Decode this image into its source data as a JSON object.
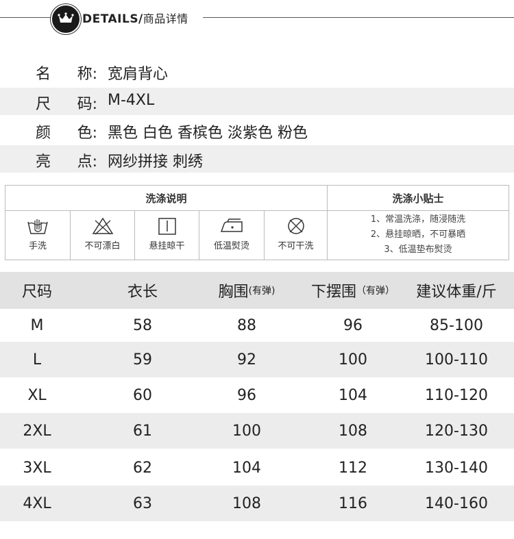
{
  "header": {
    "title": "DETAILS/",
    "subtitle": "商品详情"
  },
  "specs": [
    {
      "label_a": "名",
      "label_b": "称:",
      "value": "宽肩背心"
    },
    {
      "label_a": "尺",
      "label_b": "码:",
      "value": "M-4XL"
    },
    {
      "label_a": "颜",
      "label_b": "色:",
      "value": "黑色 白色 香槟色 淡紫色 粉色"
    },
    {
      "label_a": "亮",
      "label_b": "点:",
      "value": "网纱拼接  刺绣"
    }
  ],
  "care": {
    "left_title": "洗涤说明",
    "right_title": "洗涤小贴士",
    "icons": [
      {
        "label": "手洗",
        "icon": "hand-wash-icon"
      },
      {
        "label": "不可漂白",
        "icon": "no-bleach-icon"
      },
      {
        "label": "悬挂晾干",
        "icon": "hang-dry-icon"
      },
      {
        "label": "低温熨烫",
        "icon": "low-iron-icon"
      },
      {
        "label": "不可干洗",
        "icon": "no-dry-clean-icon"
      }
    ],
    "tips": [
      "1、常温洗涤，随浸随洗",
      "2、悬挂晾晒，不可暴晒",
      "3、低温垫布熨烫"
    ]
  },
  "size_table": {
    "headers": {
      "size": "尺码",
      "length": "衣长",
      "chest": "胸围",
      "chest_note": "(有弹)",
      "hem": "下摆围",
      "hem_note": "（有弹）",
      "weight": "建议体重/斤"
    },
    "rows": [
      [
        "M",
        "58",
        "88",
        "96",
        "85-100"
      ],
      [
        "L",
        "59",
        "92",
        "100",
        "100-110"
      ],
      [
        "XL",
        "60",
        "96",
        "104",
        "110-120"
      ],
      [
        "2XL",
        "61",
        "100",
        "108",
        "120-130"
      ],
      [
        "3XL",
        "62",
        "104",
        "112",
        "130-140"
      ],
      [
        "4XL",
        "63",
        "108",
        "116",
        "140-160"
      ]
    ]
  }
}
